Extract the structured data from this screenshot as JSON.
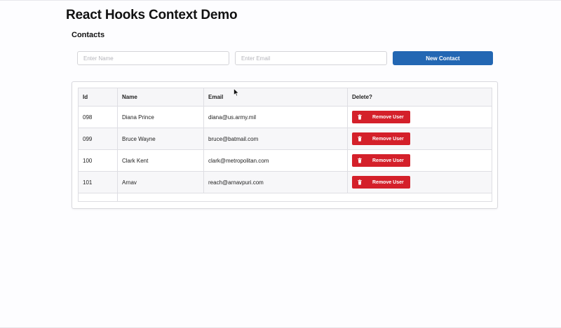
{
  "header": {
    "title": "React Hooks Context Demo"
  },
  "contacts_section": {
    "title": "Contacts",
    "name_input": {
      "placeholder": "Enter Name",
      "value": ""
    },
    "email_input": {
      "placeholder": "Enter Email",
      "value": ""
    },
    "new_contact_label": "New Contact"
  },
  "table": {
    "headers": [
      "Id",
      "Name",
      "Email",
      "Delete?"
    ],
    "rows": [
      {
        "id": "098",
        "name": "Diana Prince",
        "email": "diana@us.army.mil",
        "action_label": "Remove User"
      },
      {
        "id": "099",
        "name": "Bruce Wayne",
        "email": "bruce@batmail.com",
        "action_label": "Remove User"
      },
      {
        "id": "100",
        "name": "Clark Kent",
        "email": "clark@metropolitan.com",
        "action_label": "Remove User"
      },
      {
        "id": "101",
        "name": "Arnav",
        "email": "reach@arnavpuri.com",
        "action_label": "Remove User"
      }
    ],
    "action_icon": "trash-icon"
  },
  "colors": {
    "primary_button": "#2367b3",
    "danger_button": "#d4202a"
  }
}
